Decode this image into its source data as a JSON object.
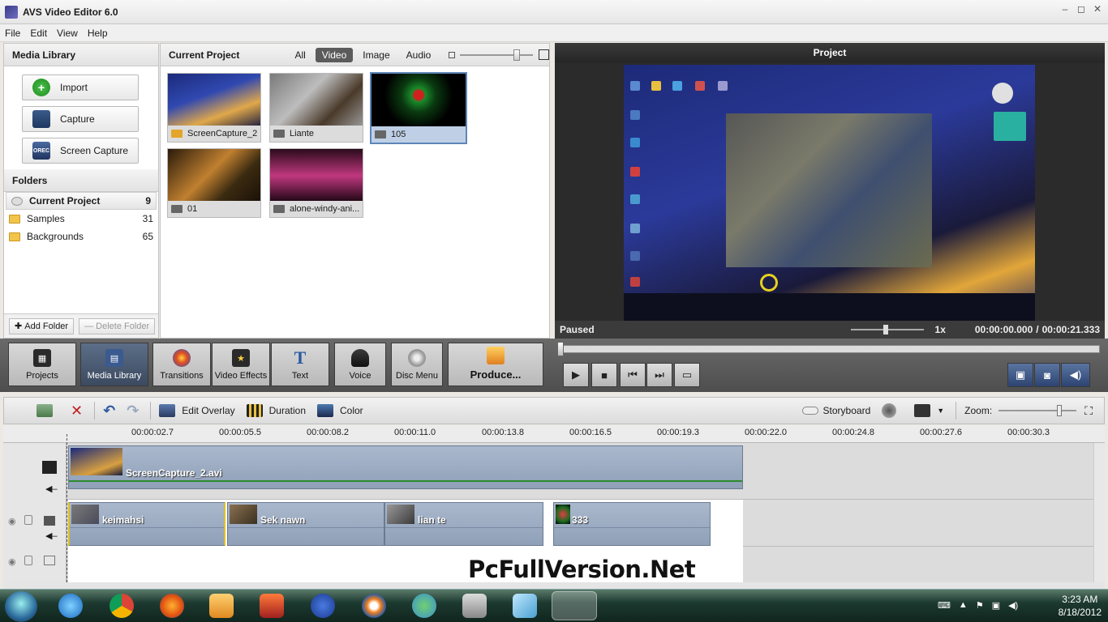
{
  "window": {
    "title": "AVS Video Editor 6.0",
    "controls": [
      "–",
      "◻",
      "✕"
    ]
  },
  "menu": [
    "File",
    "Edit",
    "View",
    "Help"
  ],
  "media_library": {
    "title": "Media Library",
    "buttons": {
      "import": "Import",
      "capture": "Capture",
      "screen_capture": "Screen Capture",
      "screen_icon_text": "OREC"
    },
    "folders_title": "Folders",
    "folders": [
      {
        "name": "Current Project",
        "count": "9"
      },
      {
        "name": "Samples",
        "count": "31"
      },
      {
        "name": "Backgrounds",
        "count": "65"
      }
    ],
    "add_folder": "Add Folder",
    "delete_folder": "Delete Folder"
  },
  "current_project": {
    "title": "Current Project",
    "filters": [
      "All",
      "Video",
      "Image",
      "Audio"
    ],
    "active_filter": "Video",
    "items": [
      {
        "name": "ScreenCapture_2"
      },
      {
        "name": "Liante"
      },
      {
        "name": "105"
      },
      {
        "name": "01"
      },
      {
        "name": "alone-windy-ani..."
      }
    ]
  },
  "preview": {
    "title": "Project",
    "status": "Paused",
    "speed": "1x",
    "current_time": "00:00:00.000",
    "separator": "/",
    "total_time": "00:00:21.333"
  },
  "tabs": {
    "projects": "Projects",
    "media_library": "Media Library",
    "transitions": "Transitions",
    "video_effects": "Video Effects",
    "text": "Text",
    "voice": "Voice",
    "disc_menu": "Disc Menu",
    "produce": "Produce..."
  },
  "timeline_toolbar": {
    "edit_overlay": "Edit Overlay",
    "duration": "Duration",
    "color": "Color",
    "storyboard": "Storyboard",
    "zoom_label": "Zoom:"
  },
  "ruler_ticks": [
    "00:00:02.7",
    "00:00:05.5",
    "00:00:08.2",
    "00:00:11.0",
    "00:00:13.8",
    "00:00:16.5",
    "00:00:19.3",
    "00:00:22.0",
    "00:00:24.8",
    "00:00:27.6",
    "00:00:30.3"
  ],
  "timeline": {
    "main_clip": "ScreenCapture_2.avi",
    "overlay_clips": [
      "keimahsi",
      "Sek nawn",
      "lian te",
      "333"
    ]
  },
  "watermark": "PcFullVersion.Net",
  "taskbar": {
    "time": "3:23 AM",
    "date": "8/18/2012"
  },
  "colors": {
    "accent": "#5e86b8",
    "timeline_clip": "#9aaac0",
    "preview_bg": "#2b2b2b",
    "taskbar": "#1d3a30"
  }
}
